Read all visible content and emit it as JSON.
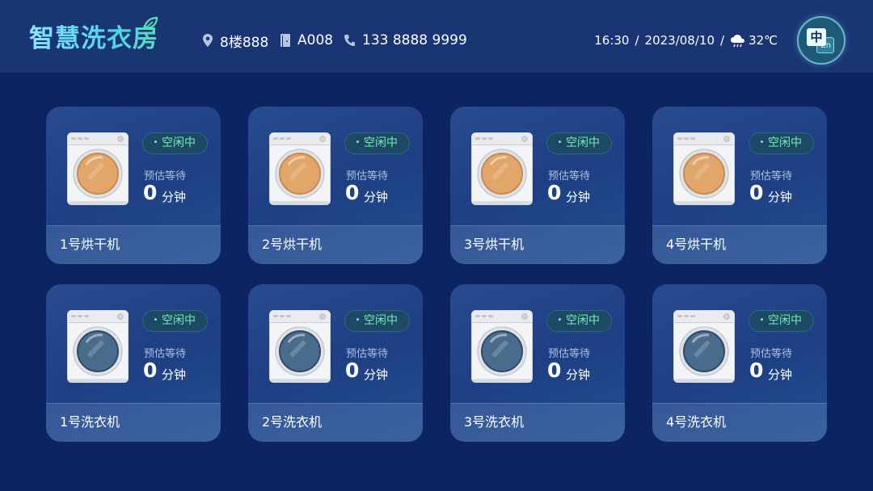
{
  "header": {
    "title": "智慧洗衣房",
    "floor": "8楼888",
    "room": "A008",
    "phone": "133 8888 9999",
    "time": "16:30",
    "separator": "/",
    "date": "2023/08/10",
    "temperature": "32℃",
    "lang_primary": "中",
    "lang_secondary": "En",
    "icons": [
      "location-pin-icon",
      "door-icon",
      "phone-icon",
      "weather-cloud-rain-icon",
      "leaf-icon",
      "language-switch-icon"
    ]
  },
  "colors": {
    "background": "#0c2462",
    "header_bg": "#1a3573",
    "status_green": "#6ff0b0",
    "dryer_drum": "#e0a66a",
    "washer_drum": "#4a6c8c"
  },
  "machines": [
    {
      "name": "1号烘干机",
      "status": "空闲中",
      "wait_label": "预估等待",
      "wait_value": "0",
      "wait_unit": "分钟",
      "kind": "dryer"
    },
    {
      "name": "2号烘干机",
      "status": "空闲中",
      "wait_label": "预估等待",
      "wait_value": "0",
      "wait_unit": "分钟",
      "kind": "dryer"
    },
    {
      "name": "3号烘干机",
      "status": "空闲中",
      "wait_label": "预估等待",
      "wait_value": "0",
      "wait_unit": "分钟",
      "kind": "dryer"
    },
    {
      "name": "4号烘干机",
      "status": "空闲中",
      "wait_label": "预估等待",
      "wait_value": "0",
      "wait_unit": "分钟",
      "kind": "dryer"
    },
    {
      "name": "1号洗衣机",
      "status": "空闲中",
      "wait_label": "预估等待",
      "wait_value": "0",
      "wait_unit": "分钟",
      "kind": "washer"
    },
    {
      "name": "2号洗衣机",
      "status": "空闲中",
      "wait_label": "预估等待",
      "wait_value": "0",
      "wait_unit": "分钟",
      "kind": "washer"
    },
    {
      "name": "3号洗衣机",
      "status": "空闲中",
      "wait_label": "预估等待",
      "wait_value": "0",
      "wait_unit": "分钟",
      "kind": "washer"
    },
    {
      "name": "4号洗衣机",
      "status": "空闲中",
      "wait_label": "预估等待",
      "wait_value": "0",
      "wait_unit": "分钟",
      "kind": "washer"
    }
  ]
}
